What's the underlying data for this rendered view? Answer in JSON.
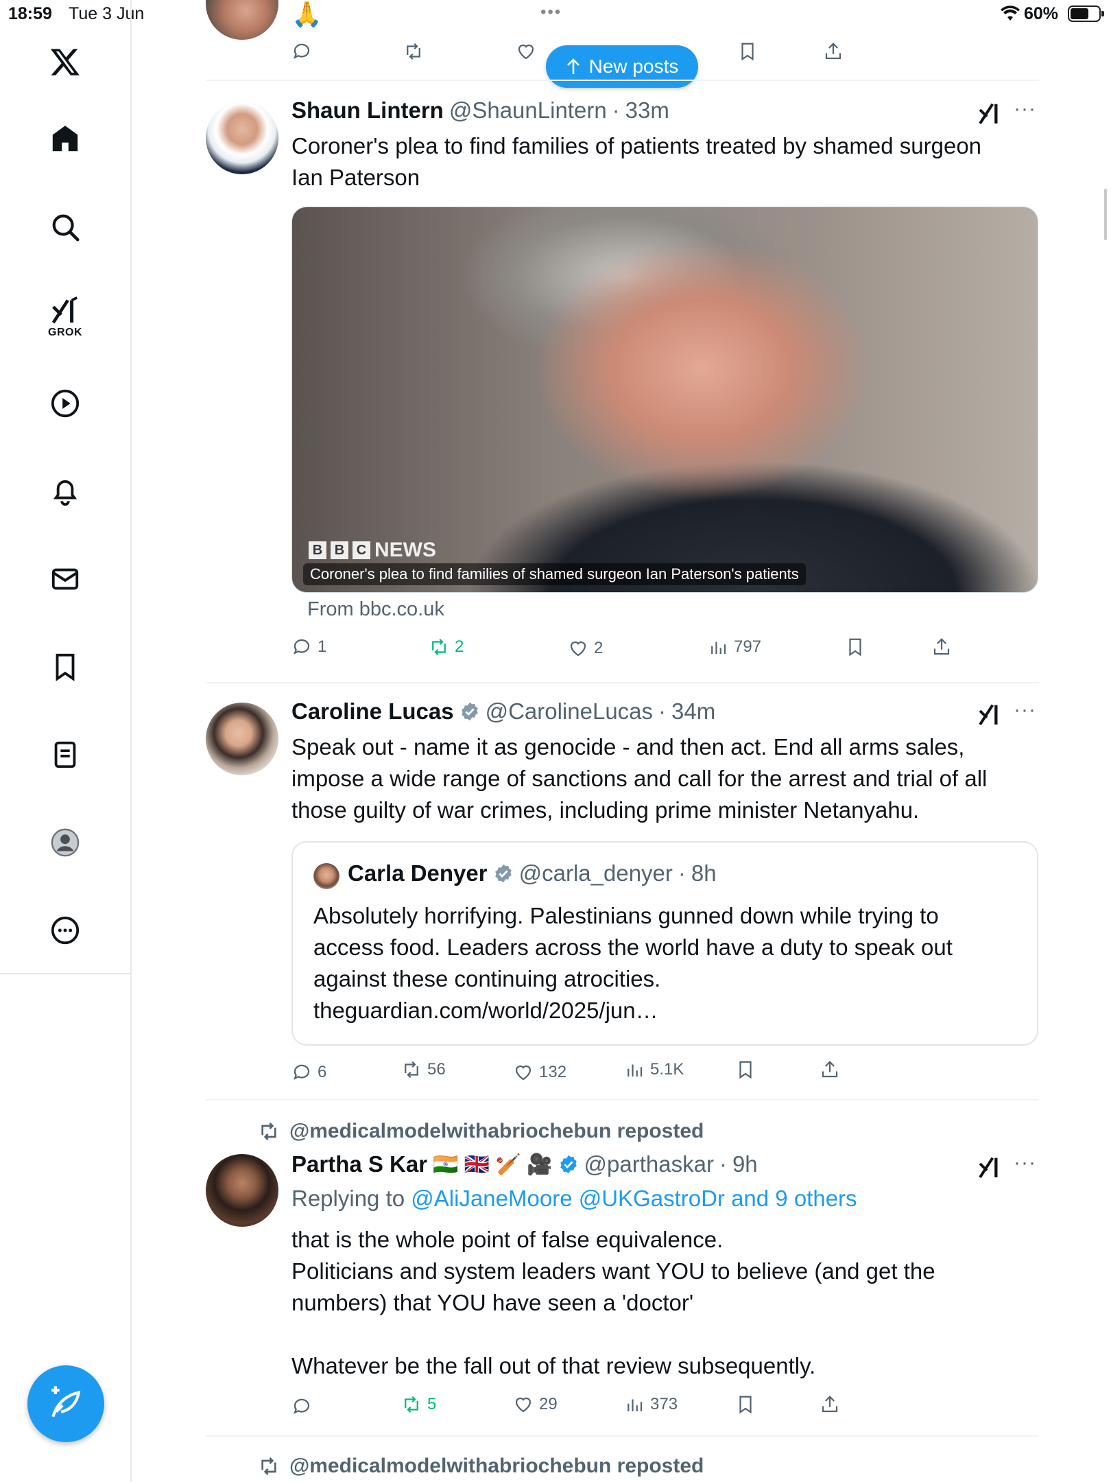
{
  "status_bar": {
    "time": "18:59",
    "date": "Tue 3 Jun",
    "battery": "60%"
  },
  "sidebar": {
    "items": [
      "x-logo",
      "home",
      "search",
      "grok",
      "videos",
      "notifications",
      "messages",
      "bookmarks",
      "lists",
      "profile",
      "more"
    ],
    "grok_label": "GROK"
  },
  "new_posts": {
    "label": "New posts"
  },
  "top_tweet": {
    "text": "🙏"
  },
  "tweets": [
    {
      "name": "Shaun Lintern",
      "handle": "@ShaunLintern",
      "time": "33m",
      "text_lines": [
        "Coroner's plea to find families of patients treated by shamed surgeon",
        "Ian Paterson"
      ],
      "media": {
        "logo": "NEWS",
        "caption": "Coroner's plea to find families of shamed surgeon Ian Paterson's patients",
        "source": "From bbc.co.uk"
      },
      "stats": {
        "replies": "1",
        "reposts": "2",
        "likes": "2",
        "views": "797"
      }
    },
    {
      "name": "Caroline Lucas",
      "handle": "@CarolineLucas",
      "time": "34m",
      "text_lines": [
        "Speak out - name it as genocide - and then act.  End all arms sales,",
        "impose a wide range of sanctions and call for the arrest and trial of all",
        "those guilty of war crimes, including prime minister Netanyahu."
      ],
      "quote": {
        "name": "Carla Denyer",
        "handle": "@carla_denyer",
        "time": "8h",
        "text_lines": [
          "Absolutely horrifying. Palestinians gunned down while trying to",
          "access food. Leaders across the world have a duty to speak out",
          "against these continuing atrocities.",
          "theguardian.com/world/2025/jun…"
        ]
      },
      "stats": {
        "replies": "6",
        "reposts": "56",
        "likes": "132",
        "views": "5.1K"
      }
    },
    {
      "repost_by": "@medicalmodelwithabriochebun reposted",
      "name": "Partha S Kar",
      "flags": "🇮🇳 🇬🇧 🏏 🎥",
      "handle": "@parthaskar",
      "time": "9h",
      "reply_prefix": "Replying to",
      "reply_to": "@AliJaneMoore @UKGastroDr and 9 others",
      "text_lines": [
        "that is the whole point of false equivalence.",
        "Politicians and system leaders want YOU to believe (and get the",
        "numbers) that YOU have seen a 'doctor'",
        "",
        "Whatever be the fall out of that review subsequently."
      ],
      "stats": {
        "replies": "",
        "reposts": "5",
        "likes": "29",
        "views": "373"
      }
    }
  ],
  "next_repost": {
    "label": "@medicalmodelwithabriochebun reposted"
  }
}
